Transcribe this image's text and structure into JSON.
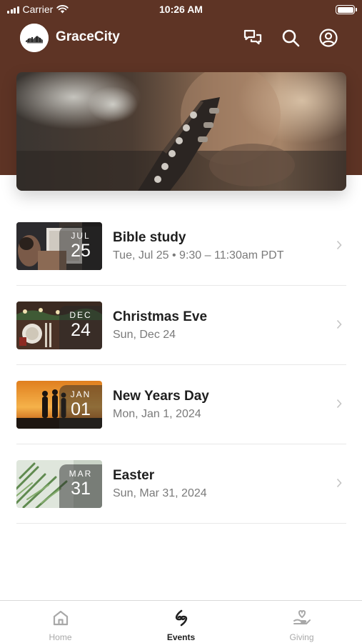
{
  "status_bar": {
    "carrier": "Carrier",
    "time": "10:26 AM"
  },
  "header": {
    "title": "GraceCity",
    "icons": [
      "chat-icon",
      "search-icon",
      "account-icon"
    ]
  },
  "colors": {
    "brand": "#5e3425",
    "text_primary": "#1f1f1f",
    "text_secondary": "#7a7a7a",
    "tab_inactive": "#a8a8a8"
  },
  "events": [
    {
      "title": "Bible study",
      "subtitle": "Tue, Jul 25 • 9:30 – 11:30am PDT",
      "month": "JUL",
      "day": "25"
    },
    {
      "title": "Christmas Eve",
      "subtitle": "Sun, Dec 24",
      "month": "DEC",
      "day": "24"
    },
    {
      "title": "New Years Day",
      "subtitle": "Mon, Jan 1, 2024",
      "month": "JAN",
      "day": "01"
    },
    {
      "title": "Easter",
      "subtitle": "Sun, Mar 31, 2024",
      "month": "MAR",
      "day": "31"
    }
  ],
  "tabs": [
    {
      "label": "Home",
      "icon": "home-icon",
      "active": false
    },
    {
      "label": "Events",
      "icon": "events-icon",
      "active": true
    },
    {
      "label": "Giving",
      "icon": "giving-icon",
      "active": false
    }
  ]
}
